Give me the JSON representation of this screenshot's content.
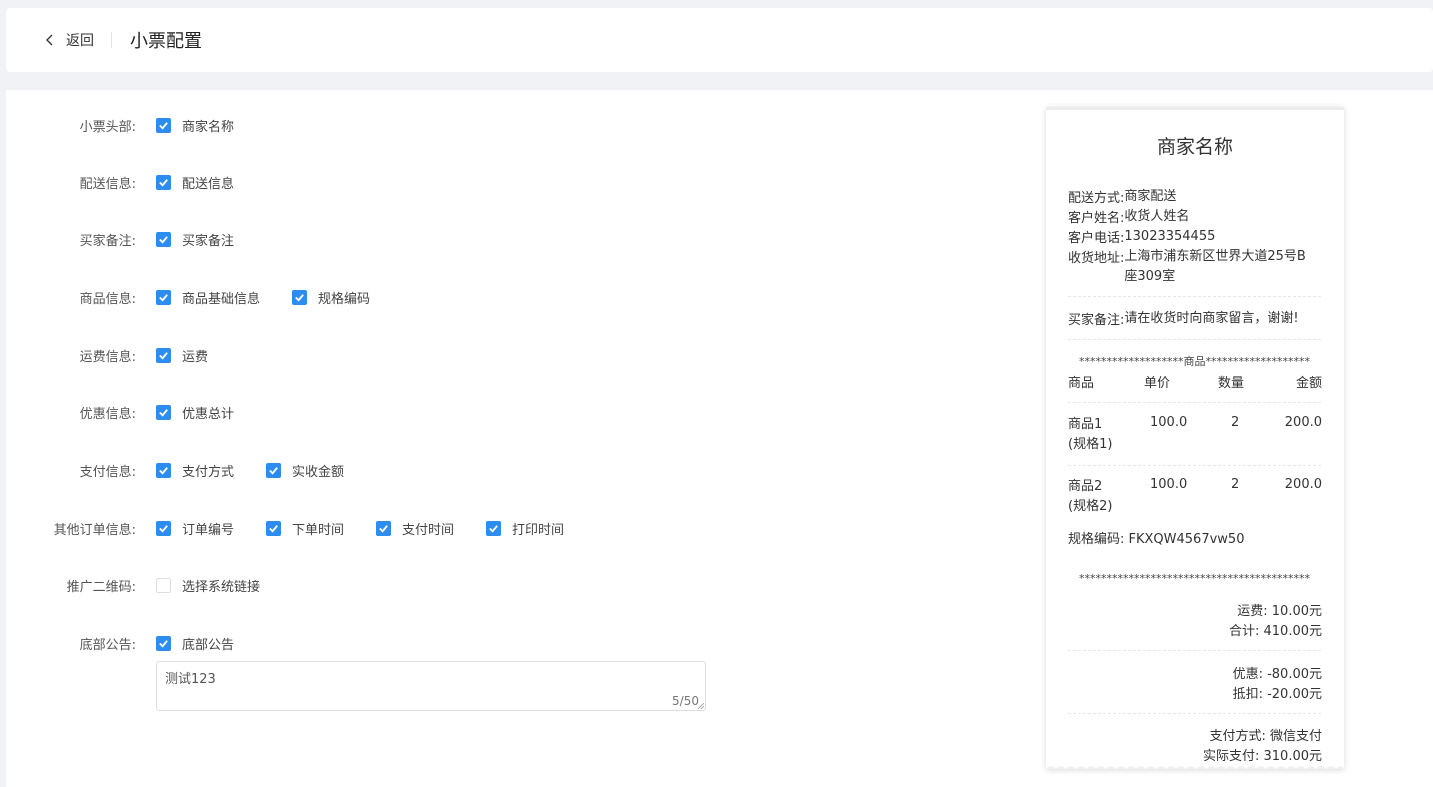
{
  "header": {
    "back_label": "返回",
    "title": "小票配置"
  },
  "form": {
    "rows": [
      {
        "label": "小票头部:",
        "options": [
          {
            "text": "商家名称",
            "checked": true
          }
        ]
      },
      {
        "label": "配送信息:",
        "options": [
          {
            "text": "配送信息",
            "checked": true
          }
        ]
      },
      {
        "label": "买家备注:",
        "options": [
          {
            "text": "买家备注",
            "checked": true
          }
        ]
      },
      {
        "label": "商品信息:",
        "options": [
          {
            "text": "商品基础信息",
            "checked": true
          },
          {
            "text": "规格编码",
            "checked": true
          }
        ]
      },
      {
        "label": "运费信息:",
        "options": [
          {
            "text": "运费",
            "checked": true
          }
        ]
      },
      {
        "label": "优惠信息:",
        "options": [
          {
            "text": "优惠总计",
            "checked": true
          }
        ]
      },
      {
        "label": "支付信息:",
        "options": [
          {
            "text": "支付方式",
            "checked": true
          },
          {
            "text": "实收金额",
            "checked": true
          }
        ]
      },
      {
        "label": "其他订单信息:",
        "options": [
          {
            "text": "订单编号",
            "checked": true
          },
          {
            "text": "下单时间",
            "checked": true
          },
          {
            "text": "支付时间",
            "checked": true
          },
          {
            "text": "打印时间",
            "checked": true
          }
        ]
      },
      {
        "label": "推广二维码:",
        "options": [
          {
            "text": "选择系统链接",
            "checked": false
          }
        ]
      },
      {
        "label": "底部公告:",
        "options": [
          {
            "text": "底部公告",
            "checked": true
          }
        ]
      }
    ],
    "notice_text": "测试123",
    "notice_counter": "5/50"
  },
  "receipt": {
    "title": "商家名称",
    "delivery": [
      {
        "key": "配送方式:",
        "value": "商家配送"
      },
      {
        "key": "客户姓名:",
        "value": "收货人姓名"
      },
      {
        "key": "客户电话:",
        "value": "13023354455"
      },
      {
        "key": "收货地址:",
        "value": "上海市浦东新区世界大道25号B座309室"
      }
    ],
    "buyer_note": {
      "key": "买家备注:",
      "value": "请在收货时向商家留言，谢谢!"
    },
    "goods_divider": "*******************商品*******************",
    "columns": [
      "商品",
      "单价",
      "数量",
      "金额"
    ],
    "items": [
      {
        "name": "商品1",
        "spec": "(规格1)",
        "price": "100.0",
        "qty": "2",
        "amount": "200.0"
      },
      {
        "name": "商品2",
        "spec": "(规格2)",
        "price": "100.0",
        "qty": "2",
        "amount": "200.0"
      }
    ],
    "spec_code": "规格编码: FKXQW4567vw50",
    "end_divider": "******************************************",
    "freight": "运费: 10.00元",
    "total": "合计: 410.00元",
    "discount": "优惠: -80.00元",
    "deduct": "抵扣: -20.00元",
    "pay_method": "支付方式: 微信支付",
    "actual_pay": "实际支付: 310.00元"
  },
  "colors": {
    "accent": "#2d8cf0"
  }
}
